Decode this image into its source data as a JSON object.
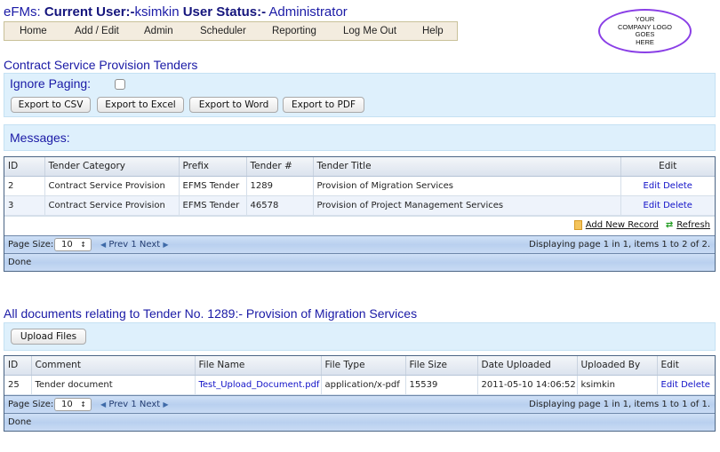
{
  "header": {
    "app": "eFMs:",
    "current_user_label": "Current User:-",
    "current_user": "ksimkin",
    "user_status_label": "User Status:-",
    "user_status": "Administrator"
  },
  "nav": {
    "items": [
      "Home",
      "Add / Edit",
      "Admin",
      "Scheduler",
      "Reporting",
      "Log Me Out",
      "Help"
    ]
  },
  "logo": {
    "lines": [
      "YOUR",
      "COMPANY LOGO",
      "GOES",
      "HERE"
    ]
  },
  "tenders": {
    "title": "Contract Service Provision Tenders",
    "ignore_paging_label": "Ignore Paging:",
    "ignore_paging_checked": false,
    "export_buttons": [
      "Export to CSV",
      "Export to Excel",
      "Export to Word",
      "Export to PDF"
    ],
    "messages_label": "Messages:",
    "columns": [
      "ID",
      "Tender Category",
      "Prefix",
      "Tender #",
      "Tender Title",
      "Edit"
    ],
    "rows": [
      {
        "id": "2",
        "category": "Contract Service Provision",
        "prefix": "EFMS Tender",
        "number": "1289",
        "title": "Provision of Migration Services",
        "edit": "Edit",
        "delete": "Delete"
      },
      {
        "id": "3",
        "category": "Contract Service Provision",
        "prefix": "EFMS Tender",
        "number": "46578",
        "title": "Provision of Project Management Services",
        "edit": "Edit",
        "delete": "Delete"
      }
    ],
    "add_new_record": "Add New Record",
    "refresh": "Refresh",
    "page_size_label": "Page Size:",
    "page_size": "10",
    "prev": "Prev",
    "page": "1",
    "next": "Next",
    "paging_info": "Displaying page 1 in 1, items 1 to 2 of 2.",
    "status": "Done"
  },
  "documents": {
    "title": "All documents relating to Tender No. 1289:- Provision of Migration Services",
    "upload_button": "Upload Files",
    "columns": [
      "ID",
      "Comment",
      "File Name",
      "File Type",
      "File Size",
      "Date Uploaded",
      "Uploaded By",
      "Edit"
    ],
    "rows": [
      {
        "id": "25",
        "comment": "Tender document",
        "file_name": "Test_Upload_Document.pdf",
        "file_type": "application/x-pdf",
        "file_size": "15539",
        "date_uploaded": "2011-05-10 14:06:52",
        "uploaded_by": "ksimkin",
        "edit": "Edit",
        "delete": "Delete"
      }
    ],
    "page_size_label": "Page Size:",
    "page_size": "10",
    "prev": "Prev",
    "page": "1",
    "next": "Next",
    "paging_info": "Displaying page 1 in 1, items 1 to 1 of 1.",
    "status": "Done"
  }
}
